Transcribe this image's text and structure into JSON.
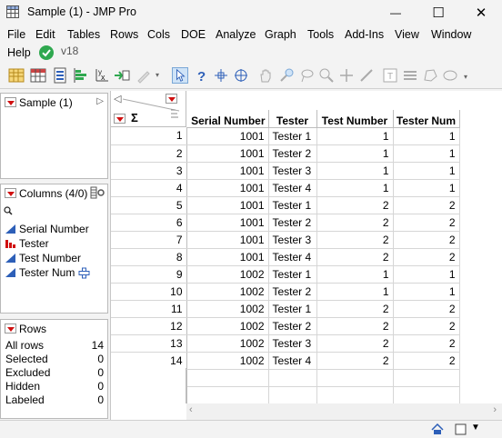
{
  "window": {
    "title": "Sample (1) - JMP Pro",
    "minimize_glyph": "—",
    "maximize_glyph": "☐",
    "close_glyph": "✕"
  },
  "menu": {
    "items": [
      "File",
      "Edit",
      "Tables",
      "Rows",
      "Cols",
      "DOE",
      "Analyze",
      "Graph",
      "Tools",
      "Add-Ins",
      "View",
      "Window",
      "Help"
    ],
    "version": "v18"
  },
  "table_panel": {
    "label": "Sample (1)"
  },
  "columns_panel": {
    "label": "Columns (4/0)",
    "search_placeholder": "",
    "columns": [
      {
        "name": "Serial Number",
        "icon": "continuous-icon"
      },
      {
        "name": "Tester",
        "icon": "nominal-icon"
      },
      {
        "name": "Test Number",
        "icon": "continuous-icon"
      },
      {
        "name": "Tester Num",
        "icon": "continuous-icon"
      }
    ]
  },
  "rows_panel": {
    "label": "Rows",
    "stats": [
      {
        "label": "All rows",
        "value": "14"
      },
      {
        "label": "Selected",
        "value": "0"
      },
      {
        "label": "Excluded",
        "value": "0"
      },
      {
        "label": "Hidden",
        "value": "0"
      },
      {
        "label": "Labeled",
        "value": "0"
      }
    ]
  },
  "grid": {
    "headers": [
      "Serial Number",
      "Tester",
      "Test Number",
      "Tester Num"
    ],
    "rows": [
      [
        "1",
        "1001",
        "Tester 1",
        "1",
        "1"
      ],
      [
        "2",
        "1001",
        "Tester 2",
        "1",
        "1"
      ],
      [
        "3",
        "1001",
        "Tester 3",
        "1",
        "1"
      ],
      [
        "4",
        "1001",
        "Tester 4",
        "1",
        "1"
      ],
      [
        "5",
        "1001",
        "Tester 1",
        "2",
        "2"
      ],
      [
        "6",
        "1001",
        "Tester 2",
        "2",
        "2"
      ],
      [
        "7",
        "1001",
        "Tester 3",
        "2",
        "2"
      ],
      [
        "8",
        "1001",
        "Tester 4",
        "2",
        "2"
      ],
      [
        "9",
        "1002",
        "Tester 1",
        "1",
        "1"
      ],
      [
        "10",
        "1002",
        "Tester 2",
        "1",
        "1"
      ],
      [
        "11",
        "1002",
        "Tester 1",
        "2",
        "2"
      ],
      [
        "12",
        "1002",
        "Tester 2",
        "2",
        "2"
      ],
      [
        "13",
        "1002",
        "Tester 3",
        "2",
        "2"
      ],
      [
        "14",
        "1002",
        "Tester 4",
        "2",
        "2"
      ]
    ]
  },
  "colors": {
    "red": "#d01010",
    "blue": "#2d5fb8",
    "check_green": "#2fa84f"
  }
}
